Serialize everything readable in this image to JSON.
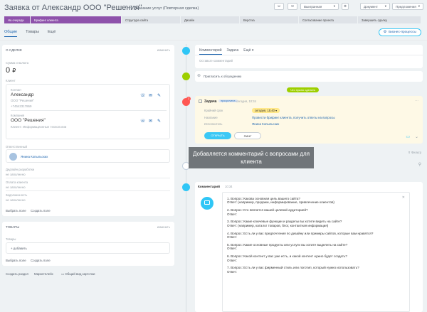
{
  "header": {
    "title": "Заявка от Александр ООО \"Решения\"",
    "subtitle": "Оказание услуг (Повторная сделка)",
    "stage_select": "Выигранная",
    "document_btn": "Документ",
    "payment_btn": "Предложения"
  },
  "stages": [
    "На очереди",
    "Брифинг клиента",
    "Структура сайта",
    "Дизайн",
    "Верстка",
    "Согласование проекта",
    "Завершить сделку"
  ],
  "tabs": [
    "Общие",
    "Товары",
    "Ещё"
  ],
  "bp_button": "Бизнес-процессы",
  "about": {
    "section_title": "О СДЕЛКЕ",
    "edit": "изменить",
    "amount_label": "Сумма и валюта",
    "amount": "0",
    "currency": "₽",
    "client_label": "Клиент",
    "contact_label": "Контакт",
    "contact_name": "Александр",
    "contact_company": "ООО \"Решения\"",
    "contact_phone": "+74542317869",
    "company_label": "Компания",
    "company_name": "ООО \"Решения\"",
    "company_type": "Клиент: Информационные технологии",
    "responsible_label": "Ответственный",
    "responsible_name": "Янина Копыльских",
    "field1_label": "Дедлайн разработки",
    "field1_value": "не заполнено",
    "field2_label": "Оплата клиента",
    "field2_value": "не заполнено",
    "field3_label": "Задолженность",
    "field3_value": "не заполнено",
    "select_field": "Выбрать поле",
    "create_field": "Создать поле"
  },
  "products": {
    "section_title": "ТОВАРЫ",
    "edit": "изменить",
    "label": "Товары",
    "add": "+ добавить",
    "select_field": "Выбрать поле",
    "create_field": "Создать поле"
  },
  "footer_links": {
    "create_section": "Создать раздел",
    "marketplace": "Маркетплейс",
    "common_view": "Общий вид карточки"
  },
  "timeline": {
    "tabs": [
      "Комментарий",
      "Задача",
      "Ещё"
    ],
    "placeholder": "Оставьте комментарий",
    "invite": "Пригласить к обсуждению",
    "planned_badge": "Что нужно сделать",
    "task": {
      "title": "Задача",
      "status": "просрочена",
      "date": "сегодня, 10:34",
      "deadline_label": "Крайний срок",
      "deadline_value": "сегодня, 15:40",
      "name_label": "Название",
      "name_value": "Провести брифинг клиента, получить ответы на вопросы",
      "executor_label": "Исполнитель",
      "executor_value": "Янина Копыльских",
      "open_btn": "ОТКРЫТЬ",
      "ping_btn": "ПИНГ"
    },
    "history_label": "История",
    "filter": "Фильтр",
    "comment": {
      "title": "Комментарий",
      "time": "10:34",
      "lines": [
        "1. Вопрос: Какова основная цель вашего сайта?",
        "Ответ: (например, продажи, информирование, привлечение клиентов)",
        "",
        "2. Вопрос: Кто является вашей целевой аудиторией?",
        "Ответ:",
        "",
        "3. Вопрос: Какие ключевые функции и разделы вы хотите видеть на сайте?",
        "Ответ: (например, каталог товаров, блог, контактная информация)",
        "",
        "4. Вопрос: Есть ли у вас предпочтения по дизайну или примеры сайтов, которые вам нравятся?",
        "Ответ:",
        "",
        "5. Вопрос: Какие основные продукты или услуги вы хотите выделить на сайте?",
        "Ответ:",
        "",
        "6. Вопрос: Какой контент у вас уже есть, и какой контент нужно будет создать?",
        "Ответ:",
        "",
        "7. Вопрос: Есть ли у вас фирменный стиль или логотип, который нужно использовать?",
        "Ответ:"
      ]
    }
  },
  "tooltip": "Добавляется комментарий с вопросами для клиента",
  "colors": {
    "stage_done": "#8e52ab",
    "accent_blue": "#2067b0",
    "green": "#9dcf00"
  }
}
